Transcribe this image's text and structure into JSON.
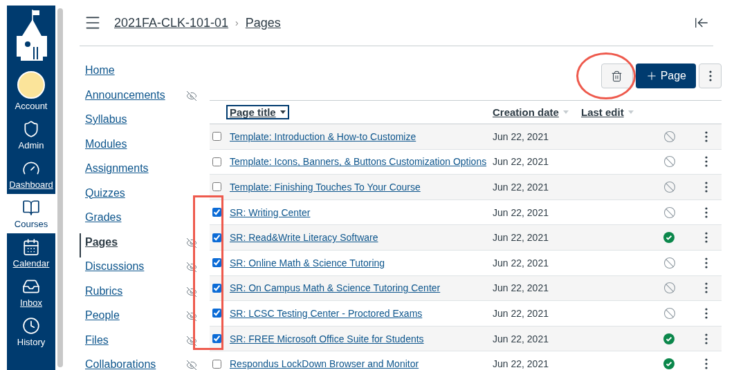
{
  "global_nav": [
    {
      "label": "Account",
      "selected": false,
      "underlined": false
    },
    {
      "label": "Admin",
      "selected": false,
      "underlined": false
    },
    {
      "label": "Dashboard",
      "selected": false,
      "underlined": true
    },
    {
      "label": "Courses",
      "selected": true,
      "underlined": false
    },
    {
      "label": "Calendar",
      "selected": false,
      "underlined": true
    },
    {
      "label": "Inbox",
      "selected": false,
      "underlined": true
    },
    {
      "label": "History",
      "selected": false,
      "underlined": false
    }
  ],
  "breadcrumb": {
    "course": "2021FA-CLK-101-01",
    "separator": "›",
    "page": "Pages"
  },
  "course_nav": [
    {
      "label": "Home",
      "hidden": false,
      "selected": false
    },
    {
      "label": "Announcements",
      "hidden": true,
      "selected": false
    },
    {
      "label": "Syllabus",
      "hidden": false,
      "selected": false
    },
    {
      "label": "Modules",
      "hidden": false,
      "selected": false
    },
    {
      "label": "Assignments",
      "hidden": false,
      "selected": false
    },
    {
      "label": "Quizzes",
      "hidden": false,
      "selected": false
    },
    {
      "label": "Grades",
      "hidden": false,
      "selected": false
    },
    {
      "label": "Pages",
      "hidden": true,
      "selected": true
    },
    {
      "label": "Discussions",
      "hidden": true,
      "selected": false
    },
    {
      "label": "Rubrics",
      "hidden": true,
      "selected": false
    },
    {
      "label": "People",
      "hidden": true,
      "selected": false
    },
    {
      "label": "Files",
      "hidden": true,
      "selected": false
    },
    {
      "label": "Collaborations",
      "hidden": true,
      "selected": false
    }
  ],
  "toolbar": {
    "new_page": "Page"
  },
  "table": {
    "columns": [
      {
        "label": "Page title",
        "focused": true
      },
      {
        "label": "Creation date",
        "focused": false
      },
      {
        "label": "Last edit",
        "focused": false
      }
    ],
    "rows": [
      {
        "title": "Template: Introduction & How-to Customize",
        "date": "Jun 22, 2021",
        "published": false,
        "checked": false
      },
      {
        "title": "Template: Icons, Banners, & Buttons Customization Options",
        "date": "Jun 22, 2021",
        "published": false,
        "checked": false
      },
      {
        "title": "Template: Finishing Touches To Your Course",
        "date": "Jun 22, 2021",
        "published": false,
        "checked": false
      },
      {
        "title": "SR: Writing Center",
        "date": "Jun 22, 2021",
        "published": false,
        "checked": true
      },
      {
        "title": "SR: Read&Write Literacy Software",
        "date": "Jun 22, 2021",
        "published": true,
        "checked": true
      },
      {
        "title": "SR: Online Math & Science Tutoring",
        "date": "Jun 22, 2021",
        "published": false,
        "checked": true
      },
      {
        "title": "SR: On Campus Math & Science Tutoring Center",
        "date": "Jun 22, 2021",
        "published": false,
        "checked": true
      },
      {
        "title": "SR: LCSC Testing Center - Proctored Exams",
        "date": "Jun 22, 2021",
        "published": false,
        "checked": true
      },
      {
        "title": "SR: FREE Microsoft Office Suite for Students",
        "date": "Jun 22, 2021",
        "published": true,
        "checked": true
      },
      {
        "title": "Respondus LockDown Browser and Monitor",
        "date": "Jun 22, 2021",
        "published": true,
        "checked": false
      }
    ]
  },
  "highlights": [
    {
      "kind": "circle"
    },
    {
      "kind": "rectangle"
    }
  ]
}
